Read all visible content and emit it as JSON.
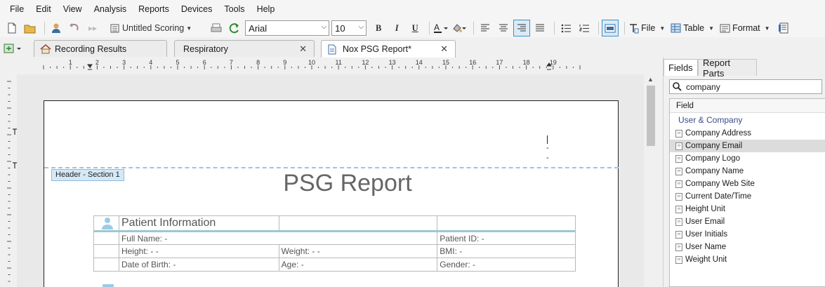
{
  "menu": [
    "File",
    "Edit",
    "View",
    "Analysis",
    "Reports",
    "Devices",
    "Tools",
    "Help"
  ],
  "toolbar": {
    "scoring_label": "Untitled Scoring",
    "font_name": "Arial",
    "font_size": "10",
    "bold": "B",
    "italic": "I",
    "underline": "U",
    "file_label": "File",
    "table_label": "Table",
    "format_label": "Format"
  },
  "tabs": [
    {
      "label": "Recording Results"
    },
    {
      "label": "Respiratory"
    },
    {
      "label": "Nox PSG Report*"
    }
  ],
  "ruler": {
    "numbers": [
      "1",
      "2",
      "3",
      "4",
      "5",
      "6",
      "7",
      "8",
      "9",
      "10",
      "11",
      "12",
      "13",
      "14",
      "15",
      "16",
      "17",
      "18",
      "19"
    ]
  },
  "page": {
    "section_tag": "Header - Section 1",
    "title": "PSG Report",
    "cursor_marks": [
      "-",
      "-"
    ],
    "table": {
      "heading": "Patient Information",
      "rows": [
        [
          "Full Name: -",
          "",
          "Patient ID: -"
        ],
        [
          "Height: - -",
          "Weight: - -",
          "BMI: -"
        ],
        [
          "Date of Birth: -",
          "Age: -",
          "Gender: -"
        ]
      ]
    }
  },
  "right_panel": {
    "tabs": [
      "Fields",
      "Report Parts"
    ],
    "search_value": "company",
    "column_header": "Field",
    "group": "User & Company",
    "fields": [
      "Company Address",
      "Company Email",
      "Company Logo",
      "Company Name",
      "Company Web Site",
      "Current Date/Time",
      "Height Unit",
      "User Email",
      "User Initials",
      "User Name",
      "Weight Unit"
    ],
    "selected_field": "Company Email"
  },
  "colors": {
    "accent": "#3a8fc9",
    "header_dash": "#9fc4df",
    "table_accent": "#9cc9cf",
    "group_text": "#3a4a8a"
  }
}
